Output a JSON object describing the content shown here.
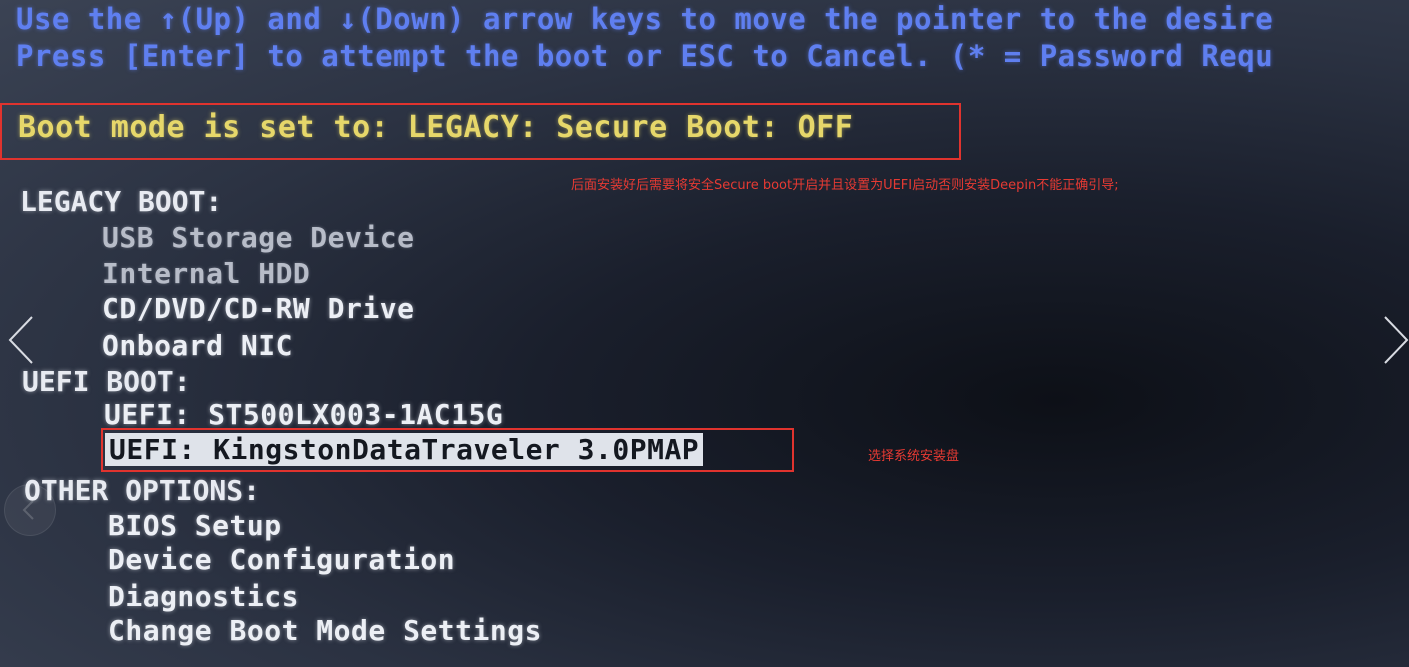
{
  "header": {
    "line1": "Use the ↑(Up) and ↓(Down) arrow keys to move the pointer to the desire",
    "line2": "Press [Enter] to attempt the boot or ESC to Cancel. (* = Password Requ"
  },
  "boot_mode": "Boot mode is set to: LEGACY: Secure Boot: OFF",
  "annotations": {
    "secure_boot_note": "后面安装好后需要将安全Secure boot开启并且设置为UEFI启动否则安装Deepin不能正确引导;",
    "select_disk_note": "选择系统安装盘"
  },
  "legacy_boot": {
    "title": "LEGACY BOOT:",
    "items": [
      "USB Storage Device",
      "Internal HDD",
      "CD/DVD/CD-RW Drive",
      "Onboard NIC"
    ]
  },
  "uefi_boot": {
    "title": "UEFI BOOT:",
    "items": [
      "UEFI: ST500LX003-1AC15G",
      "UEFI: KingstonDataTraveler 3.0PMAP"
    ]
  },
  "other_options": {
    "title": "OTHER OPTIONS:",
    "items": [
      "BIOS Setup",
      "Device Configuration",
      "Diagnostics",
      "Change Boot Mode Settings"
    ]
  },
  "icons": {
    "prev": "chevron-left-icon",
    "next": "chevron-right-icon",
    "circle": "circle-back-button"
  },
  "colors": {
    "header_text": "#5f7ff0",
    "boot_mode_text": "#e6d76a",
    "highlight_box": "#e0332e",
    "selected_bg": "#dfe3ea"
  }
}
